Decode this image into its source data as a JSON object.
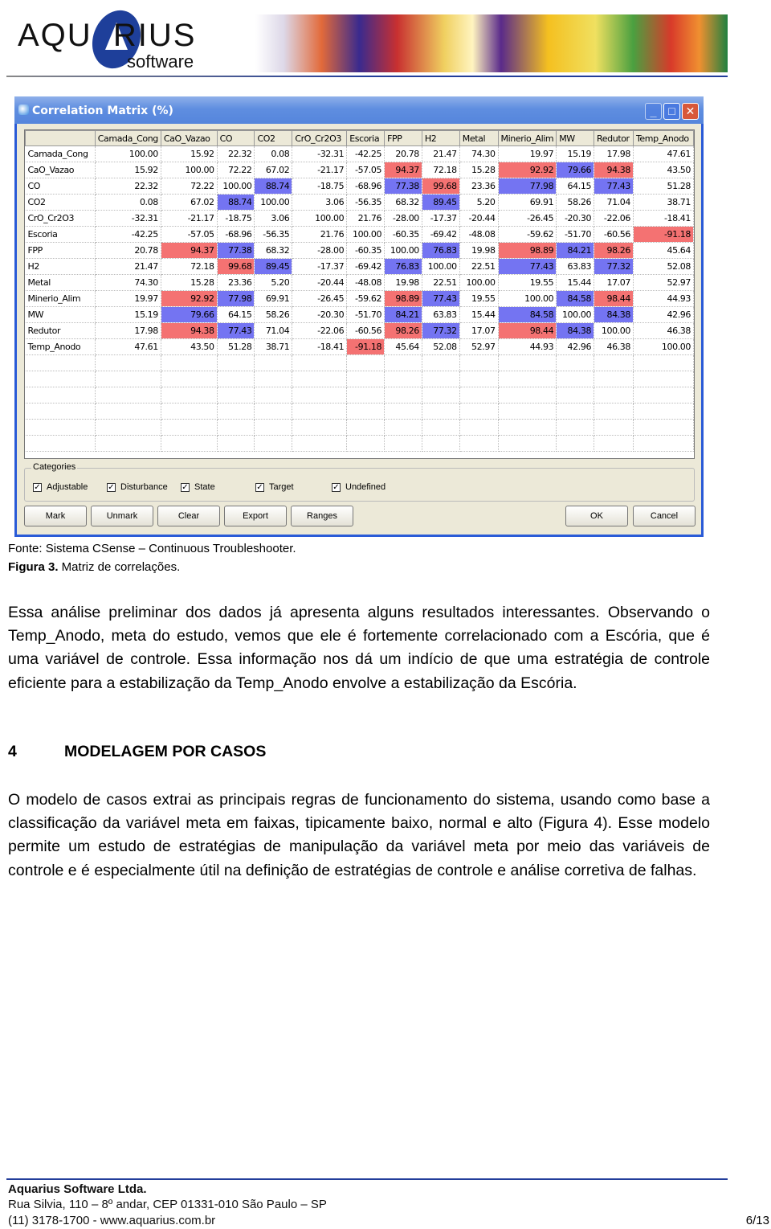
{
  "header": {
    "logo_text": "AQUARIUS",
    "logo_sub": "software"
  },
  "window": {
    "title": "Correlation Matrix (%)",
    "minimize": "_",
    "maximize": "□",
    "close": "✕"
  },
  "matrix": {
    "columns": [
      "",
      "Camada_Cong",
      "CaO_Vazao",
      "CO",
      "CO2",
      "CrO_Cr2O3",
      "Escoria",
      "FPP",
      "H2",
      "Metal",
      "Minerio_Alim",
      "MW",
      "Redutor",
      "Temp_Anodo"
    ],
    "rows": [
      {
        "label": "Camada_Cong",
        "values": [
          "100.00",
          "15.92",
          "22.32",
          "0.08",
          "-32.31",
          "-42.25",
          "20.78",
          "21.47",
          "74.30",
          "19.97",
          "15.19",
          "17.98",
          "47.61"
        ]
      },
      {
        "label": "CaO_Vazao",
        "values": [
          "15.92",
          "100.00",
          "72.22",
          "67.02",
          "-21.17",
          "-57.05",
          "94.37",
          "72.18",
          "15.28",
          "92.92",
          "79.66",
          "94.38",
          "43.50"
        ]
      },
      {
        "label": "CO",
        "values": [
          "22.32",
          "72.22",
          "100.00",
          "88.74",
          "-18.75",
          "-68.96",
          "77.38",
          "99.68",
          "23.36",
          "77.98",
          "64.15",
          "77.43",
          "51.28"
        ]
      },
      {
        "label": "CO2",
        "values": [
          "0.08",
          "67.02",
          "88.74",
          "100.00",
          "3.06",
          "-56.35",
          "68.32",
          "89.45",
          "5.20",
          "69.91",
          "58.26",
          "71.04",
          "38.71"
        ]
      },
      {
        "label": "CrO_Cr2O3",
        "values": [
          "-32.31",
          "-21.17",
          "-18.75",
          "3.06",
          "100.00",
          "21.76",
          "-28.00",
          "-17.37",
          "-20.44",
          "-26.45",
          "-20.30",
          "-22.06",
          "-18.41"
        ]
      },
      {
        "label": "Escoria",
        "values": [
          "-42.25",
          "-57.05",
          "-68.96",
          "-56.35",
          "21.76",
          "100.00",
          "-60.35",
          "-69.42",
          "-48.08",
          "-59.62",
          "-51.70",
          "-60.56",
          "-91.18"
        ]
      },
      {
        "label": "FPP",
        "values": [
          "20.78",
          "94.37",
          "77.38",
          "68.32",
          "-28.00",
          "-60.35",
          "100.00",
          "76.83",
          "19.98",
          "98.89",
          "84.21",
          "98.26",
          "45.64"
        ]
      },
      {
        "label": "H2",
        "values": [
          "21.47",
          "72.18",
          "99.68",
          "89.45",
          "-17.37",
          "-69.42",
          "76.83",
          "100.00",
          "22.51",
          "77.43",
          "63.83",
          "77.32",
          "52.08"
        ]
      },
      {
        "label": "Metal",
        "values": [
          "74.30",
          "15.28",
          "23.36",
          "5.20",
          "-20.44",
          "-48.08",
          "19.98",
          "22.51",
          "100.00",
          "19.55",
          "15.44",
          "17.07",
          "52.97"
        ]
      },
      {
        "label": "Minerio_Alim",
        "values": [
          "19.97",
          "92.92",
          "77.98",
          "69.91",
          "-26.45",
          "-59.62",
          "98.89",
          "77.43",
          "19.55",
          "100.00",
          "84.58",
          "98.44",
          "44.93"
        ]
      },
      {
        "label": "MW",
        "values": [
          "15.19",
          "79.66",
          "64.15",
          "58.26",
          "-20.30",
          "-51.70",
          "84.21",
          "63.83",
          "15.44",
          "84.58",
          "100.00",
          "84.38",
          "42.96"
        ]
      },
      {
        "label": "Redutor",
        "values": [
          "17.98",
          "94.38",
          "77.43",
          "71.04",
          "-22.06",
          "-60.56",
          "98.26",
          "77.32",
          "17.07",
          "98.44",
          "84.38",
          "100.00",
          "46.38"
        ]
      },
      {
        "label": "Temp_Anodo",
        "values": [
          "47.61",
          "43.50",
          "51.28",
          "38.71",
          "-18.41",
          "-91.18",
          "45.64",
          "52.08",
          "52.97",
          "44.93",
          "42.96",
          "46.38",
          "100.00"
        ]
      }
    ],
    "highlight_colors": {
      "strong": "#f47272",
      "moderate": "#7474f2"
    },
    "highlight_thresholds": {
      "strong_abs_min": 90,
      "moderate_abs_min": 75
    }
  },
  "categories": {
    "label": "Categories",
    "items": [
      {
        "label": "Adjustable",
        "checked": true
      },
      {
        "label": "Disturbance",
        "checked": true
      },
      {
        "label": "State",
        "checked": true
      },
      {
        "label": "Target",
        "checked": true
      },
      {
        "label": "Undefined",
        "checked": true
      }
    ]
  },
  "buttons": {
    "mark": "Mark",
    "unmark": "Unmark",
    "clear": "Clear",
    "export": "Export",
    "ranges": "Ranges",
    "ok": "OK",
    "cancel": "Cancel"
  },
  "caption": {
    "source": "Fonte:  Sistema CSense – Continuous Troubleshooter.",
    "figure_bold": "Figura 3.",
    "figure_text": " Matriz de correlações."
  },
  "body": {
    "para1": "Essa análise preliminar dos dados já apresenta alguns resultados interessantes. Observando o Temp_Anodo, meta do estudo, vemos que ele é fortemente correlacionado com a Escória, que é uma variável de controle. Essa informação nos dá um indício de que uma estratégia de controle eficiente para a estabilização da Temp_Anodo envolve a estabilização da Escória.",
    "section_number": "4",
    "section_title": "MODELAGEM POR CASOS",
    "para2": "O modelo de casos extrai as principais regras de funcionamento do sistema, usando como base a classificação da variável meta em faixas, tipicamente baixo, normal e alto (Figura 4). Esse modelo permite um estudo de estratégias de manipulação da variável meta por meio das variáveis de controle e é especialmente útil na definição de estratégias de controle e análise corretiva de falhas."
  },
  "footer": {
    "company": "Aquarius Software Ltda.",
    "address": "Rua Silvia, 110 – 8º andar, CEP 01331-010 São Paulo – SP",
    "contact": "(11) 3178-1700 - www.aquarius.com.br",
    "page": "6/13"
  }
}
